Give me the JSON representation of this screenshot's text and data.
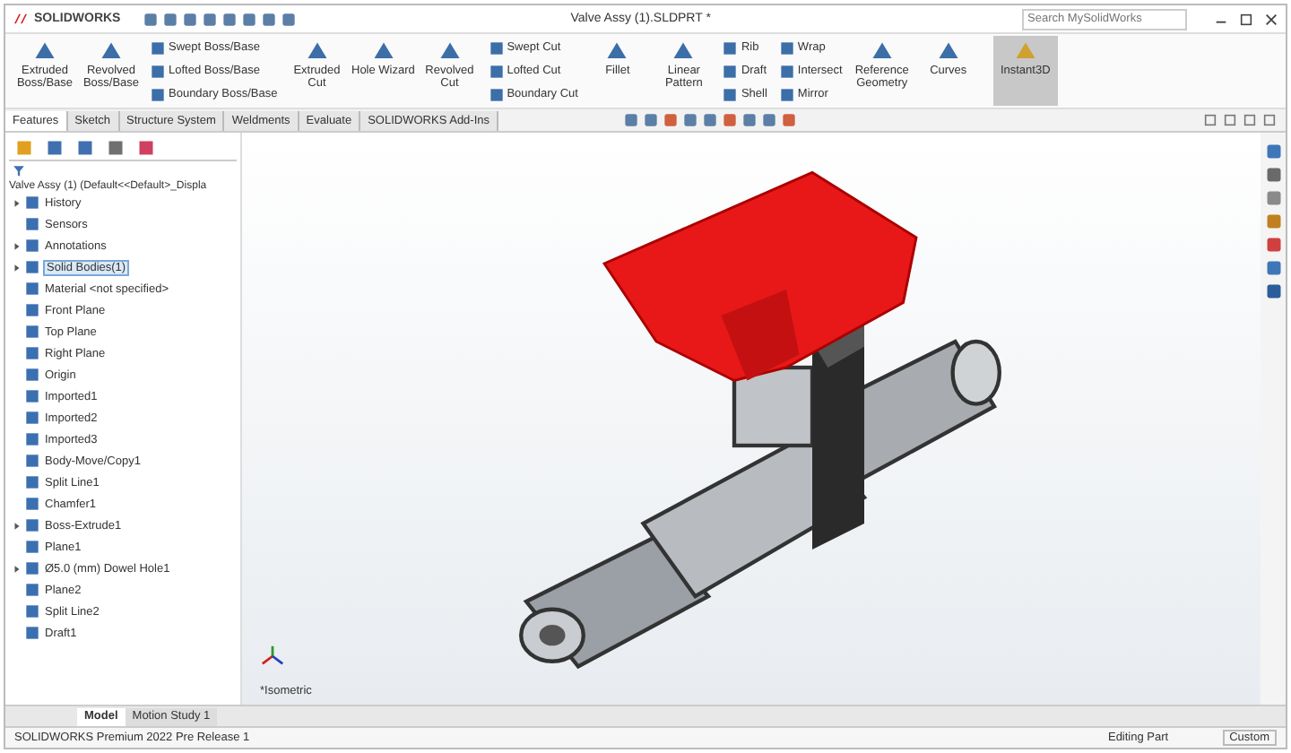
{
  "app": {
    "logo": "SOLIDWORKS",
    "title": "Valve Assy (1).SLDPRT *",
    "search": {
      "placeholder": "Search MySolidWorks"
    }
  },
  "ribbon": [
    {
      "kind": "large",
      "label": "Extruded Boss/Base"
    },
    {
      "kind": "large",
      "label": "Revolved Boss/Base"
    },
    {
      "kind": "stack",
      "items": [
        "Swept Boss/Base",
        "Lofted Boss/Base",
        "Boundary Boss/Base"
      ]
    },
    {
      "kind": "large",
      "label": "Extruded Cut"
    },
    {
      "kind": "large",
      "label": "Hole Wizard"
    },
    {
      "kind": "large",
      "label": "Revolved Cut"
    },
    {
      "kind": "stack",
      "items": [
        "Swept Cut",
        "Lofted Cut",
        "Boundary Cut"
      ]
    },
    {
      "kind": "large",
      "label": "Fillet"
    },
    {
      "kind": "large",
      "label": "Linear Pattern"
    },
    {
      "kind": "stack",
      "items": [
        "Rib",
        "Draft",
        "Shell"
      ]
    },
    {
      "kind": "stack",
      "items": [
        "Wrap",
        "Intersect",
        "Mirror"
      ]
    },
    {
      "kind": "large",
      "label": "Reference Geometry"
    },
    {
      "kind": "large",
      "label": "Curves"
    }
  ],
  "instant3d": {
    "label": "Instant3D",
    "on": true
  },
  "tabs": [
    {
      "label": "Features",
      "selected": true
    },
    {
      "label": "Sketch",
      "selected": false
    },
    {
      "label": "Structure System",
      "selected": false
    },
    {
      "label": "Weldments",
      "selected": false
    },
    {
      "label": "Evaluate",
      "selected": false
    },
    {
      "label": "SOLIDWORKS Add-Ins",
      "selected": false
    }
  ],
  "tree": {
    "root": "Valve Assy (1) (Default<<Default>_Displa",
    "items": [
      {
        "label": "History",
        "arrow": true,
        "selected": false
      },
      {
        "label": "Sensors",
        "arrow": false,
        "selected": false
      },
      {
        "label": "Annotations",
        "arrow": true,
        "selected": false
      },
      {
        "label": "Solid Bodies(1)",
        "arrow": true,
        "selected": true
      },
      {
        "label": "Material <not specified>",
        "arrow": false,
        "selected": false
      },
      {
        "label": "Front Plane",
        "arrow": false,
        "selected": false
      },
      {
        "label": "Top Plane",
        "arrow": false,
        "selected": false
      },
      {
        "label": "Right Plane",
        "arrow": false,
        "selected": false
      },
      {
        "label": "Origin",
        "arrow": false,
        "selected": false
      },
      {
        "label": "Imported1",
        "arrow": false,
        "selected": false
      },
      {
        "label": "Imported2",
        "arrow": false,
        "selected": false
      },
      {
        "label": "Imported3",
        "arrow": false,
        "selected": false
      },
      {
        "label": "Body-Move/Copy1",
        "arrow": false,
        "selected": false
      },
      {
        "label": "Split Line1",
        "arrow": false,
        "selected": false
      },
      {
        "label": "Chamfer1",
        "arrow": false,
        "selected": false
      },
      {
        "label": "Boss-Extrude1",
        "arrow": true,
        "selected": false
      },
      {
        "label": "Plane1",
        "arrow": false,
        "selected": false
      },
      {
        "label": "Ø5.0 (mm) Dowel Hole1",
        "arrow": true,
        "selected": false
      },
      {
        "label": "Plane2",
        "arrow": false,
        "selected": false
      },
      {
        "label": "Split Line2",
        "arrow": false,
        "selected": false
      },
      {
        "label": "Draft1",
        "arrow": false,
        "selected": false
      }
    ]
  },
  "viewport": {
    "view_name": "*Isometric"
  },
  "bottom_tabs": [
    {
      "label": "Model",
      "selected": true
    },
    {
      "label": "Motion Study 1",
      "selected": false
    }
  ],
  "status_bar": {
    "product": "SOLIDWORKS Premium 2022 Pre Release 1",
    "mode": "Editing Part",
    "units": "Custom"
  }
}
